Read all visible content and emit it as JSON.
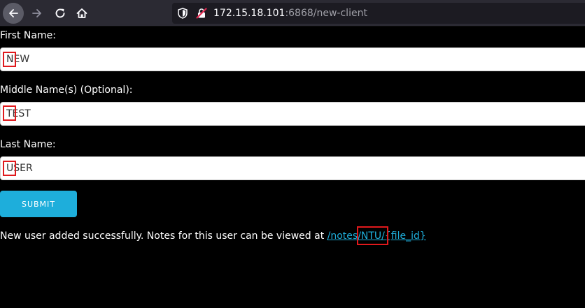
{
  "browser": {
    "url_host": "172.15.18.101",
    "url_rest": ":6868/new-client"
  },
  "form": {
    "first_name_label": "First Name:",
    "first_name_value": "NEW",
    "middle_name_label": "Middle Name(s) (Optional):",
    "middle_name_value": "TEST",
    "last_name_label": "Last Name:",
    "last_name_value": "USER",
    "submit_label": "SUBMIT"
  },
  "result": {
    "message_text": "New user added successfully. Notes for this user can be viewed at ",
    "notes_link_text": "/notes/NTU/{file_id}"
  },
  "colors": {
    "background": "#000000",
    "accent": "#1eaedb",
    "marker": "#e0191c",
    "toolbar": "#2b2a33"
  },
  "icons": [
    "back-arrow-icon",
    "forward-arrow-icon",
    "reload-icon",
    "home-icon",
    "tracking-shield-icon",
    "insecure-lock-icon"
  ]
}
